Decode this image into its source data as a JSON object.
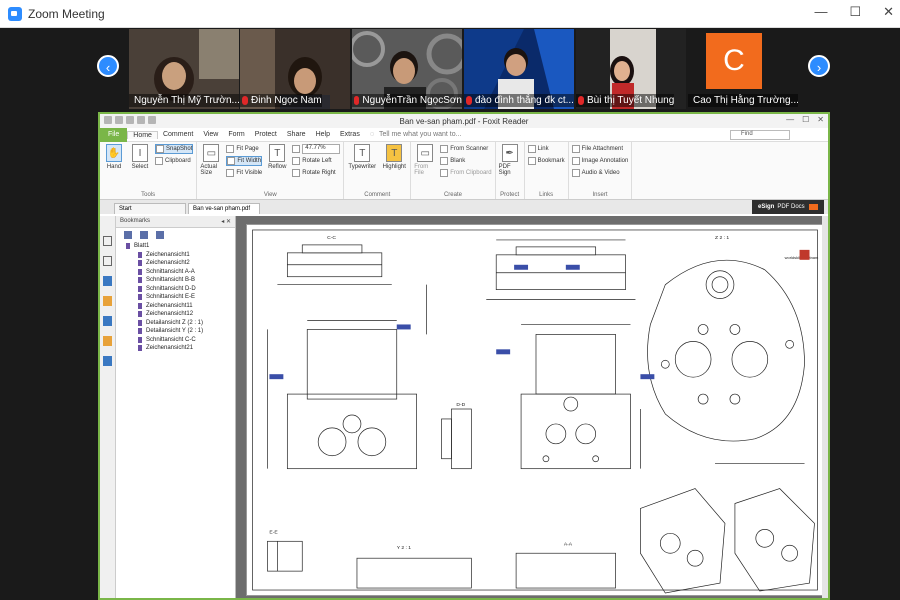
{
  "zoom": {
    "title": "Zoom Meeting",
    "window_controls": [
      "—",
      "☐",
      "✕"
    ],
    "prev_arrow": "‹",
    "next_arrow": "›",
    "participants": [
      {
        "name": "Nguyễn Thị Mỹ Trườn..."
      },
      {
        "name": "Đinh Ngọc Nam"
      },
      {
        "name": "NguyễnTrần NgọcSơn"
      },
      {
        "name": "đào đình thắng đk ct..."
      },
      {
        "name": "Bùi thị Tuyết Nhung"
      },
      {
        "name": "Cao Thị Hằng Trường...",
        "avatar_letter": "C"
      }
    ],
    "colors": {
      "accent": "#2d8cff",
      "avatar": "#f26b1d",
      "mic_muted": "#e02828"
    }
  },
  "reader": {
    "title": "Ban ve-san pham.pdf - Foxit Reader",
    "menu": [
      "File",
      "Home",
      "Comment",
      "View",
      "Form",
      "Protect",
      "Share",
      "Help",
      "Extras"
    ],
    "tell_me": "Tell me what you want to...",
    "find_placeholder": "Find",
    "ribbon": {
      "hand": "Hand",
      "select": "Select",
      "snapshot": "SnapShot",
      "clipboard": "Clipboard",
      "tools_label": "Tools",
      "actual_size": "Actual Size",
      "fit_page": "Fit Page",
      "fit_width": "Fit Width",
      "fit_visible": "Fit Visible",
      "reflow": "Reflow",
      "zoom_value": "47.77%",
      "rotate_left": "Rotate Left",
      "rotate_right": "Rotate Right",
      "view_label": "View",
      "typewriter": "Typewriter",
      "highlight": "Highlight",
      "comment_label": "Comment",
      "from_file": "From File",
      "from_scanner": "From Scanner",
      "blank": "Blank",
      "from_clipboard": "From Clipboard",
      "create_label": "Create",
      "pdf_sign": "PDF Sign",
      "protect_label": "Protect",
      "link": "Link",
      "bookmark": "Bookmark",
      "links_label": "Links",
      "file_attachment": "File Attachment",
      "image_annotation": "Image Annotation",
      "audio_video": "Audio & Video",
      "insert_label": "Insert"
    },
    "tabs": [
      "Start",
      "Ban ve-san pham.pdf"
    ],
    "esign": {
      "brand": "eSign",
      "label": "PDF Docs"
    },
    "bookmarks": {
      "header": "Bookmarks",
      "items": [
        {
          "label": "Blatt1",
          "child": false
        },
        {
          "label": "Zeichenansicht1",
          "child": true
        },
        {
          "label": "Zeichenansicht2",
          "child": true
        },
        {
          "label": "Schnittansicht A-A",
          "child": true
        },
        {
          "label": "Schnittansicht B-B",
          "child": true
        },
        {
          "label": "Schnittansicht D-D",
          "child": true
        },
        {
          "label": "Schnittansicht E-E",
          "child": true
        },
        {
          "label": "Zeichenansicht11",
          "child": true
        },
        {
          "label": "Zeichenansicht12",
          "child": true
        },
        {
          "label": "Detailansicht Z (2 : 1)",
          "child": true
        },
        {
          "label": "Detailansicht Y (2 : 1)",
          "child": true
        },
        {
          "label": "Schnittansicht C-C",
          "child": true
        },
        {
          "label": "Zeichenansicht21",
          "child": true
        }
      ]
    },
    "drawing_labels": {
      "cc": "C-C",
      "scale1": "Z 2 : 1",
      "dd": "D-D",
      "ee": "E-E",
      "y21": "Y 2 : 1",
      "aa": "A-A",
      "logo": "worldskills Vietnam"
    },
    "colors": {
      "frame": "#7ab648",
      "ink": "#222222",
      "bookmark": "#6a4fa3"
    }
  }
}
